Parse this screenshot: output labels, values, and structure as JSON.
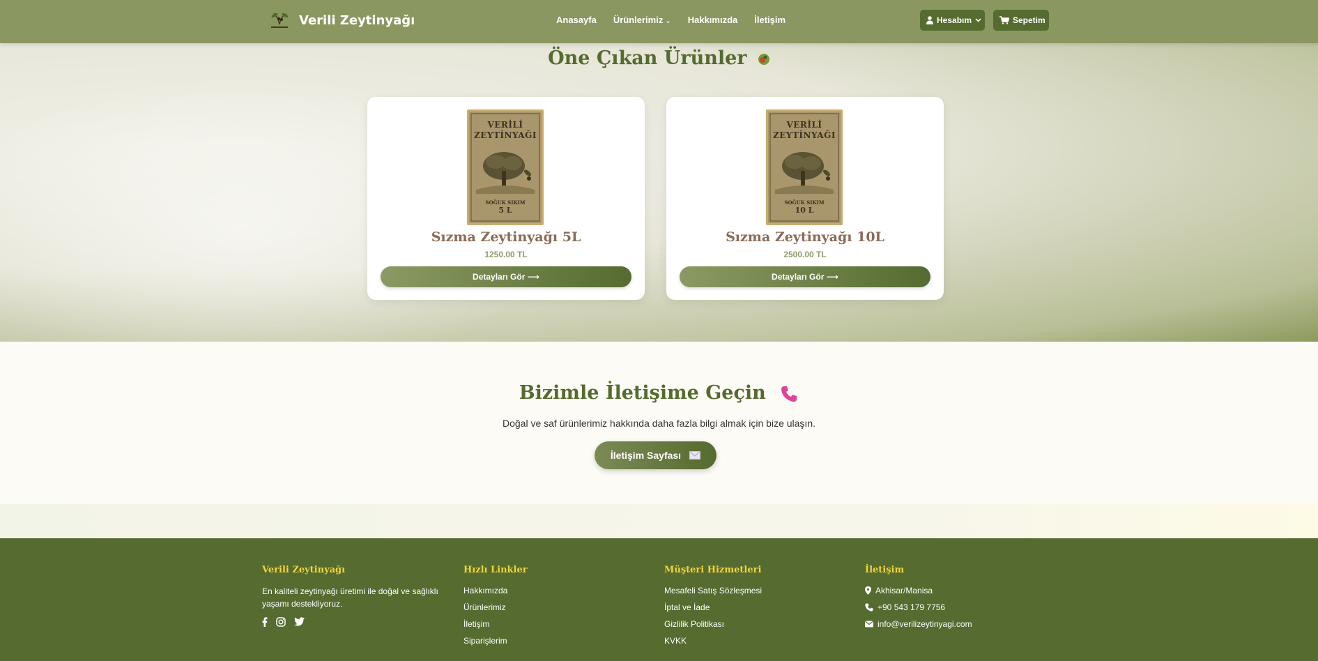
{
  "nav": {
    "brand": "Verili Zeytinyağı",
    "links": [
      "Anasayfa",
      "Ürünlerimiz",
      "Hakkımızda",
      "İletişim"
    ],
    "account_label": "Hesabım",
    "cart_label": "Sepetim"
  },
  "featured": {
    "title": "Öne Çıkan Ürünler",
    "products": [
      {
        "name": "Sızma Zeytinyağı 5L",
        "price": "1250.00 TL",
        "button": "Detayları Gör",
        "label_brand_1": "VERİLİ",
        "label_brand_2": "ZEYTİNYAĞI",
        "label_type": "SOĞUK SIKIM",
        "label_size": "5 L"
      },
      {
        "name": "Sızma Zeytinyağı 10L",
        "price": "2500.00 TL",
        "button": "Detayları Gör",
        "label_brand_1": "VERİLİ",
        "label_brand_2": "ZEYTİNYAĞI",
        "label_type": "SOĞUK SIKIM",
        "label_size": "10 L"
      }
    ]
  },
  "contact": {
    "title": "Bizimle İletişime Geçin",
    "text": "Doğal ve saf ürünlerimiz hakkında daha fazla bilgi almak için bize ulaşın.",
    "button": "İletişim Sayfası"
  },
  "footer": {
    "about": {
      "title": "Verili Zeytinyağı",
      "desc": "En kaliteli zeytinyağı üretimi ile doğal ve sağlıklı yaşamı destekliyoruz."
    },
    "quick_links": {
      "title": "Hızlı Linkler",
      "items": [
        "Hakkımızda",
        "Ürünlerimiz",
        "İletişim",
        "Siparişlerim"
      ]
    },
    "customer_service": {
      "title": "Müşteri Hizmetleri",
      "items": [
        "Mesafeli Satış Sözleşmesi",
        "İptal ve İade",
        "Gizlilik Politikası",
        "KVKK"
      ]
    },
    "contact_info": {
      "title": "İletişim",
      "location": "Akhisar/Manisa",
      "phone": "+90 543 179 7756",
      "email": "info@verilizeytinyagi.com"
    }
  },
  "colors": {
    "navbar": "#8a9760",
    "brand_green": "#556b2f",
    "footer_heading": "#f2d53c",
    "product_name": "#8b6a55"
  }
}
